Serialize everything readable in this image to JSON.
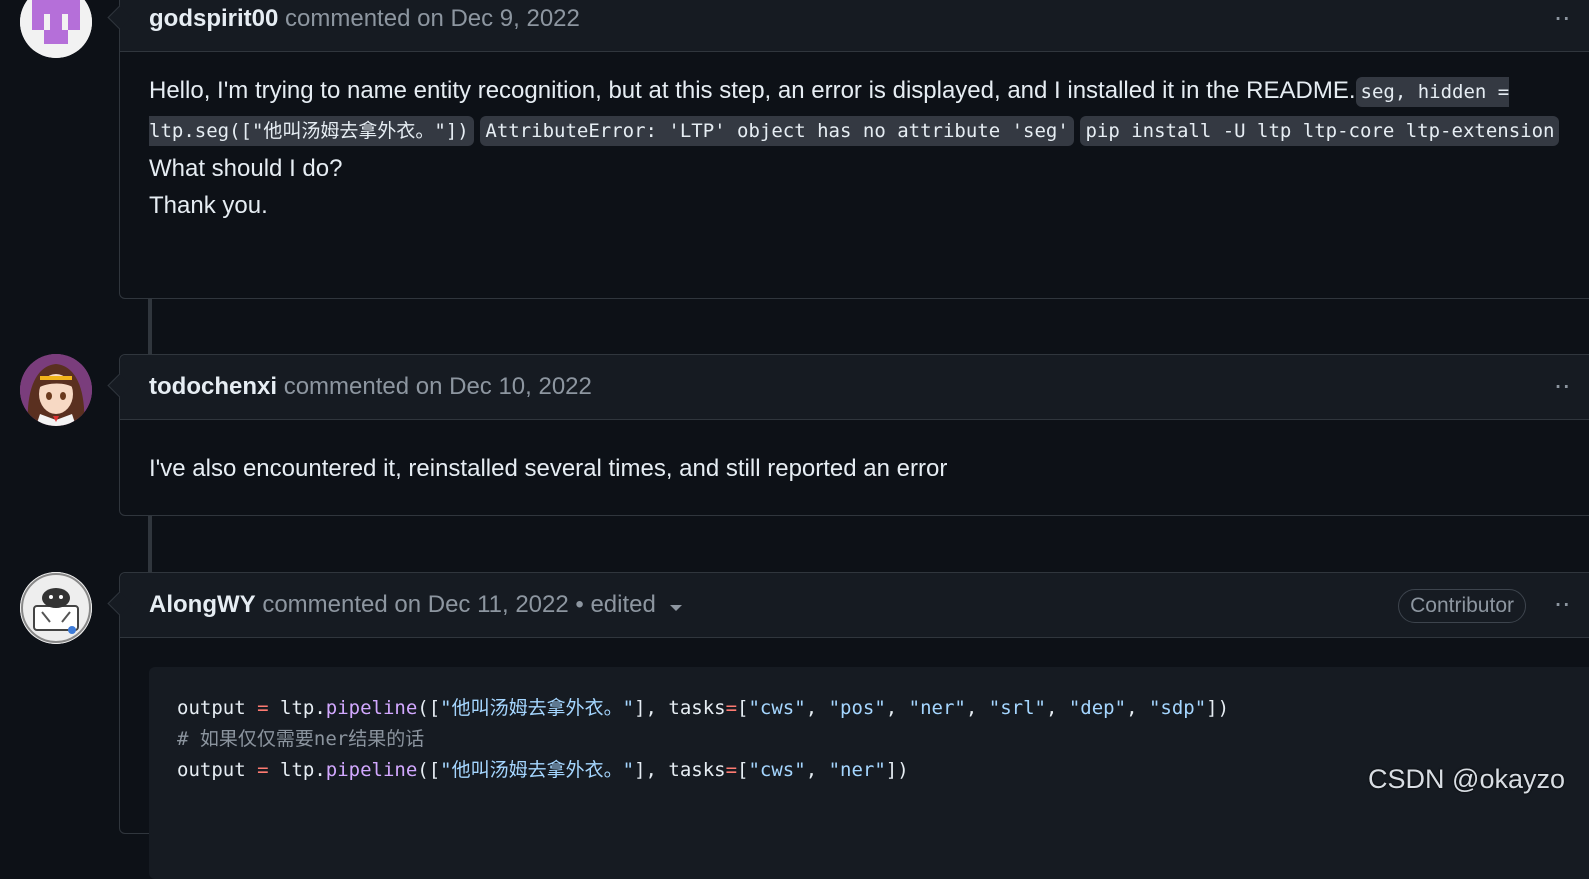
{
  "comments": [
    {
      "author": "godspirit00",
      "meta": "commented on Dec 9, 2022",
      "body_text": "Hello, I'm trying to name entity recognition, but at this step, an error is displayed, and I installed it in the README.",
      "code1": "seg, hidden = ltp.seg([\"他叫汤姆去拿外衣。\"])",
      "code2": "AttributeError: 'LTP' object has no attribute 'seg'",
      "code3": "pip install -U ltp ltp-core ltp-extension",
      "line2": "What should I do?",
      "line3": "Thank you."
    },
    {
      "author": "todochenxi",
      "meta": "commented on Dec 10, 2022",
      "body_text": "I've also encountered it, reinstalled several times, and still reported an error"
    },
    {
      "author": "AlongWY",
      "meta": "commented on Dec 11, 2022 • edited",
      "badge": "Contributor",
      "code_lines": {
        "l1_var": "output",
        "l1_eq": "=",
        "l1_obj": "ltp.",
        "l1_fn": "pipeline",
        "l1_open": "([",
        "l1_s1": "\"他叫汤姆去拿外衣。\"",
        "l1_mid": "], tasks",
        "l1_eq2": "=",
        "l1_br": "[",
        "l1_t1": "\"cws\"",
        "l1_t2": "\"pos\"",
        "l1_t3": "\"ner\"",
        "l1_t4": "\"srl\"",
        "l1_t5": "\"dep\"",
        "l1_t6": "\"sdp\"",
        "l1_end": "])",
        "l2_comment": "# 如果仅仅需要ner结果的话",
        "l3_var": "output",
        "l3_eq": "=",
        "l3_obj": "ltp.",
        "l3_fn": "pipeline",
        "l3_open": "([",
        "l3_s1": "\"他叫汤姆去拿外衣。\"",
        "l3_mid": "], tasks",
        "l3_eq2": "=",
        "l3_br": "[",
        "l3_t1": "\"cws\"",
        "l3_t2": "\"ner\"",
        "l3_end": "])"
      }
    }
  ],
  "kebab": "··",
  "watermark": "CSDN @okayzo"
}
